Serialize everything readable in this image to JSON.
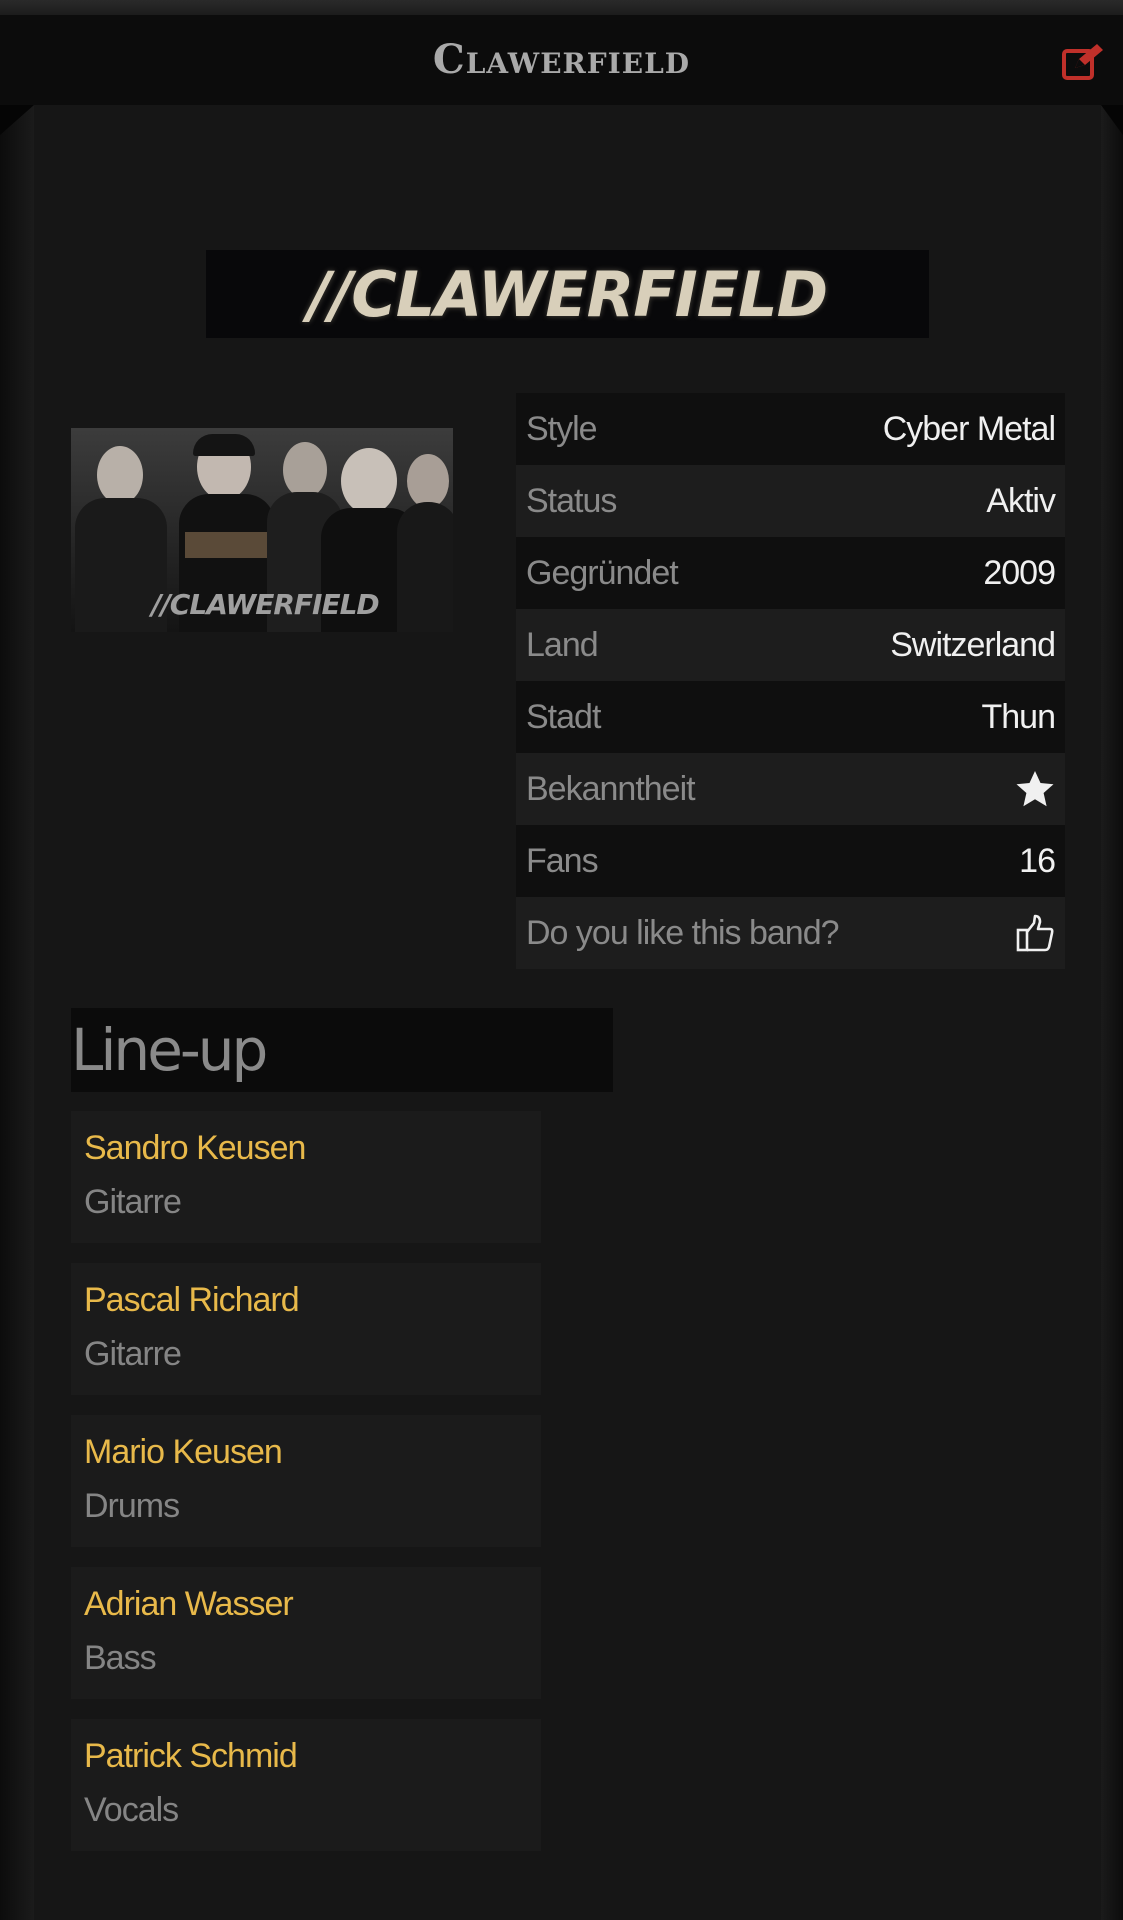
{
  "header": {
    "title": "Clawerfield",
    "edit_icon": "edit-icon"
  },
  "band": {
    "logo_text": "//CLAWERFIELD",
    "photo_caption": "//CLAWERFIELD"
  },
  "info": [
    {
      "label": "Style",
      "value": "Cyber Metal"
    },
    {
      "label": "Status",
      "value": "Aktiv"
    },
    {
      "label": "Gegründet",
      "value": "2009"
    },
    {
      "label": "Land",
      "value": "Switzerland"
    },
    {
      "label": "Stadt",
      "value": "Thun"
    },
    {
      "label": "Bekanntheit",
      "icon": "star-icon"
    },
    {
      "label": "Fans",
      "value": "16"
    },
    {
      "label": "Do you like this band?",
      "icon": "thumbs-up-icon"
    }
  ],
  "lineup": {
    "title": "Line-up",
    "members": [
      {
        "name": "Sandro Keusen",
        "role": "Gitarre"
      },
      {
        "name": "Pascal Richard",
        "role": "Gitarre"
      },
      {
        "name": "Mario Keusen",
        "role": "Drums"
      },
      {
        "name": "Adrian Wasser",
        "role": "Bass"
      },
      {
        "name": "Patrick Schmid",
        "role": "Vocals"
      }
    ]
  },
  "colors": {
    "accent_red": "#c0302a",
    "member_name": "#e8b94a"
  }
}
